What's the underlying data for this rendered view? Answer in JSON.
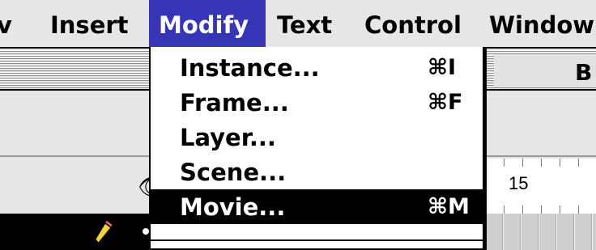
{
  "menubar": {
    "titles": [
      {
        "label": "v"
      },
      {
        "label": "Insert"
      },
      {
        "label": "Modify"
      },
      {
        "label": "Text"
      },
      {
        "label": "Control"
      },
      {
        "label": "Window"
      }
    ],
    "active_index": 2
  },
  "dropdown": {
    "items": [
      {
        "label": "Instance...",
        "shortcut": "⌘I"
      },
      {
        "label": "Frame...",
        "shortcut": "⌘F"
      },
      {
        "label": "Layer...",
        "shortcut": ""
      },
      {
        "label": "Scene...",
        "shortcut": ""
      },
      {
        "label": "Movie...",
        "shortcut": "⌘M"
      }
    ],
    "highlighted_index": 4
  },
  "window": {
    "title_fragment": "B",
    "ruler_label": "15"
  },
  "colors": {
    "menu_active": "#3535b5",
    "menu_highlight": "#000000",
    "menubar_bg": "#e6e6e6"
  },
  "icons": {
    "eye": "eye-icon",
    "pencil": "pencil-icon"
  }
}
